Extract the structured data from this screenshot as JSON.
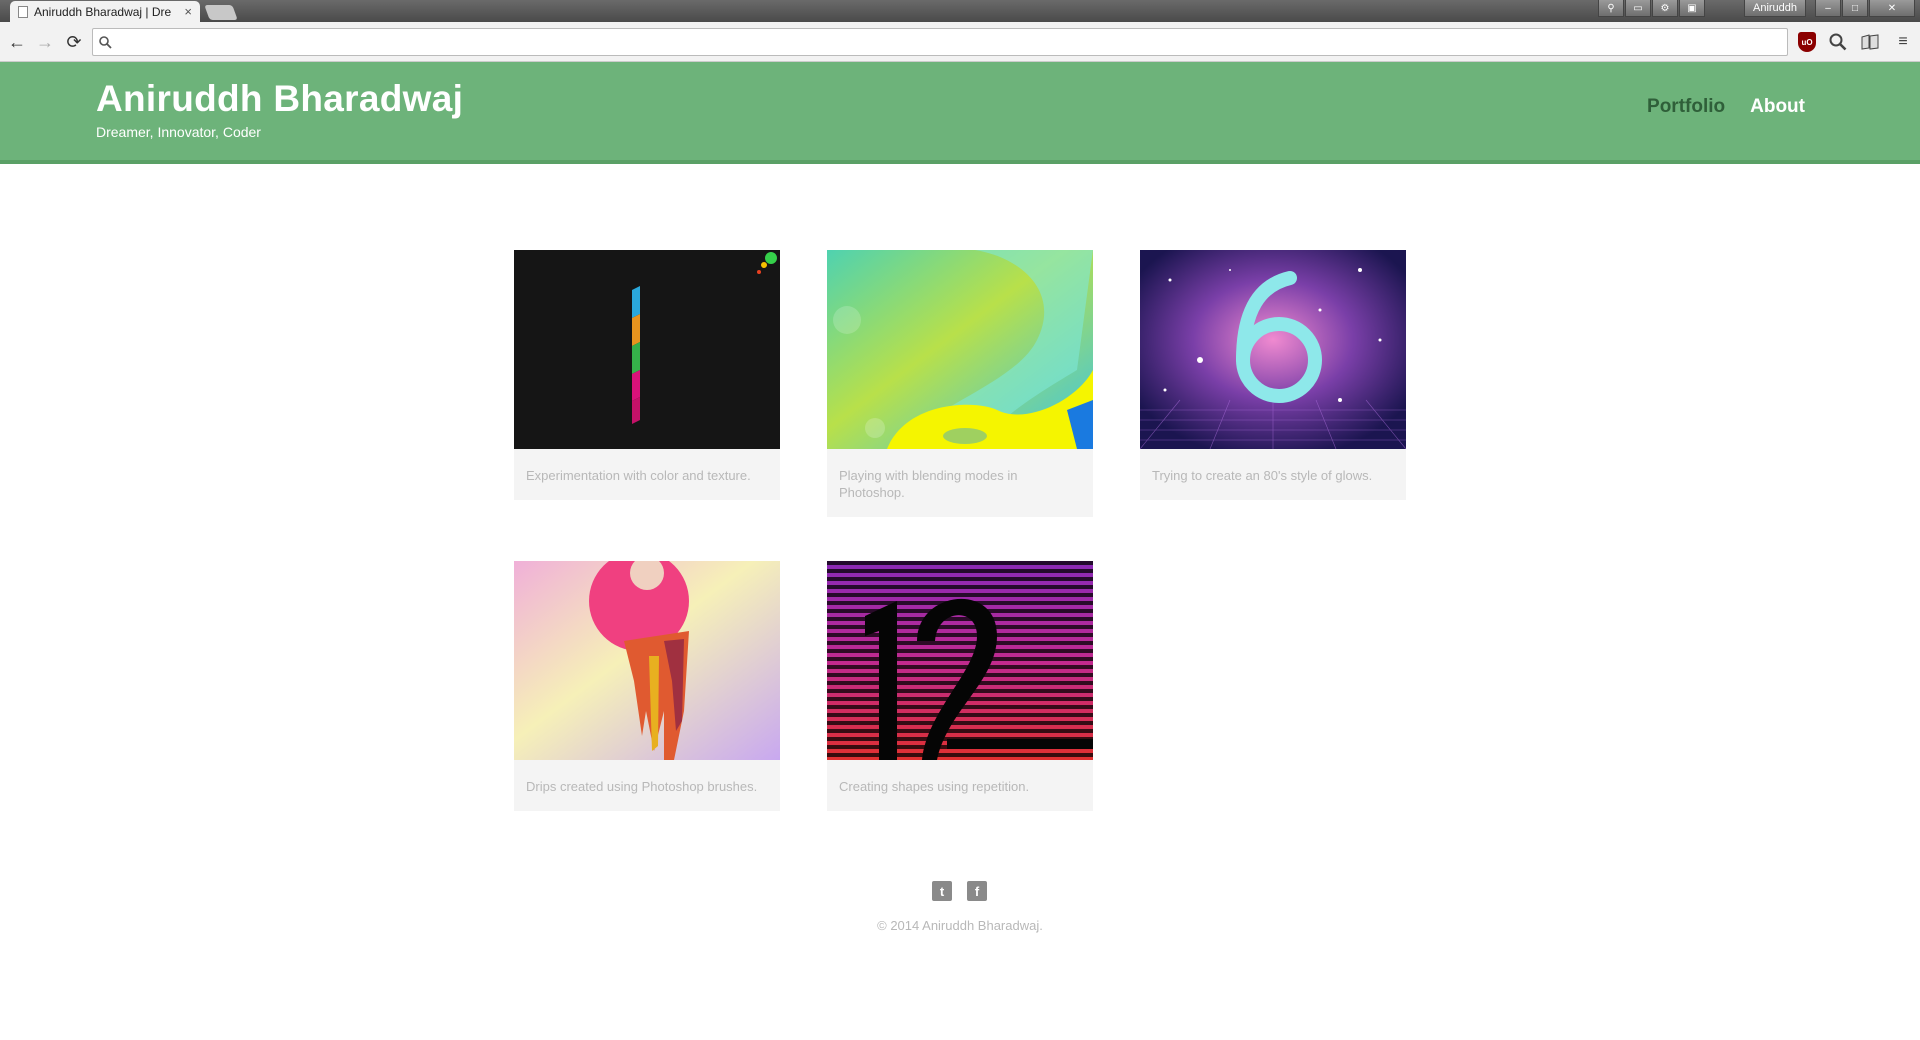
{
  "browser": {
    "tab_title": "Aniruddh Bharadwaj | Dre",
    "tab_close": "×",
    "profile_name": "Aniruddh",
    "omnibox_value": "",
    "back_glyph": "←",
    "forward_glyph": "→",
    "reload_glyph": "⟳",
    "menu_glyph": "≡",
    "ublock_label": "uO"
  },
  "header": {
    "title": "Aniruddh Bharadwaj",
    "tagline": "Dreamer, Innovator, Coder",
    "nav": [
      {
        "label": "Portfolio"
      },
      {
        "label": "About"
      }
    ]
  },
  "portfolio": {
    "items": [
      {
        "caption": "Experimentation with color and texture.",
        "icon": "artwork-number-1"
      },
      {
        "caption": "Playing with blending modes in Photoshop.",
        "icon": "artwork-number-2"
      },
      {
        "caption": "Trying to create an 80's style of glows.",
        "icon": "artwork-number-6"
      },
      {
        "caption": "Drips created using Photoshop brushes.",
        "icon": "artwork-number-9"
      },
      {
        "caption": "Creating shapes using repetition.",
        "icon": "artwork-number-12"
      }
    ]
  },
  "footer": {
    "twitter_glyph": "t",
    "facebook_glyph": "f",
    "copyright": "© 2014 Aniruddh Bharadwaj."
  },
  "colors": {
    "header_bg": "#6db37a",
    "nav_active": "#2f5f39",
    "caption_text": "#b8b8b8"
  }
}
